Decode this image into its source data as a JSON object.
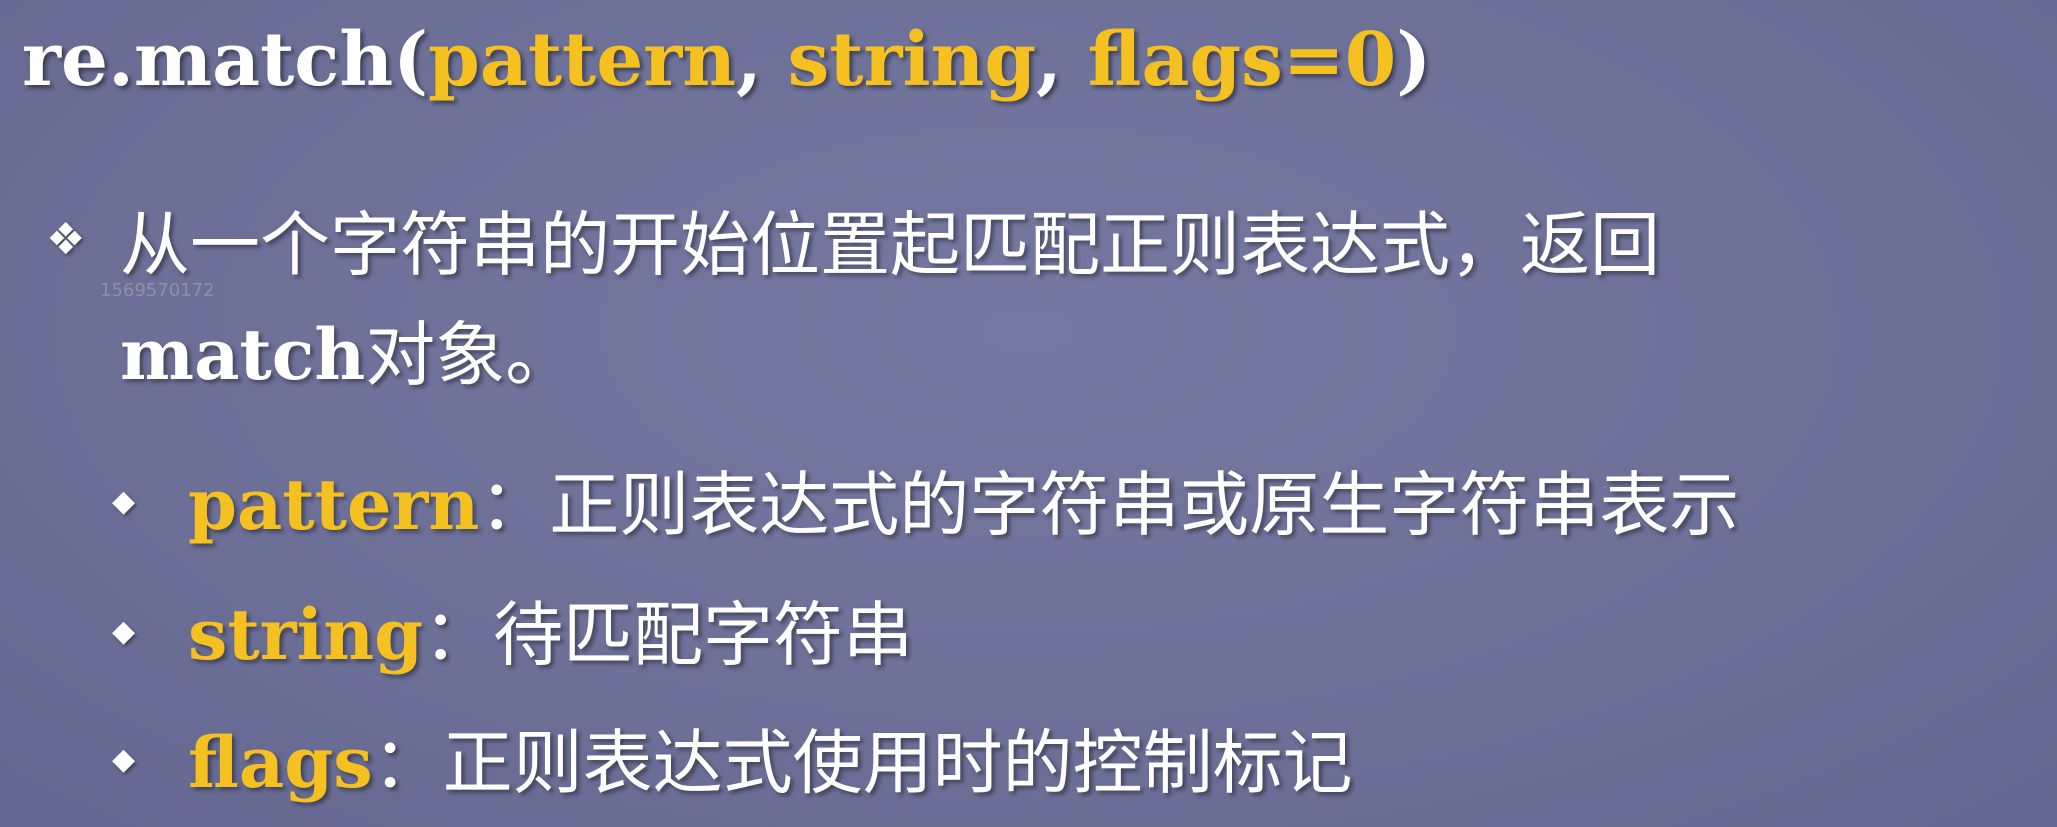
{
  "title": {
    "func": "re.match(",
    "arg1": "pattern",
    "sep1": ", ",
    "arg2": "string",
    "sep2": ", ",
    "arg3": "flags=0",
    "close": ")"
  },
  "main_bullet": {
    "icon": "diamond-bullet-icon",
    "text_part1": "从一个字符串的开始位置起匹配正则表达式，返回",
    "text_en": "match",
    "text_part2": "对象。"
  },
  "watermark": "1569570172",
  "params": [
    {
      "name": "pattern",
      "sep": "：",
      "desc": "正则表达式的字符串或原生字符串表示"
    },
    {
      "name": "string",
      "sep": "：",
      "desc": "待匹配字符串"
    },
    {
      "name": "flags",
      "sep": "：",
      "desc": "正则表达式使用时的控制标记"
    }
  ],
  "colors": {
    "background": "#6c7097",
    "accent": "#f5c120",
    "text": "#ffffff"
  }
}
